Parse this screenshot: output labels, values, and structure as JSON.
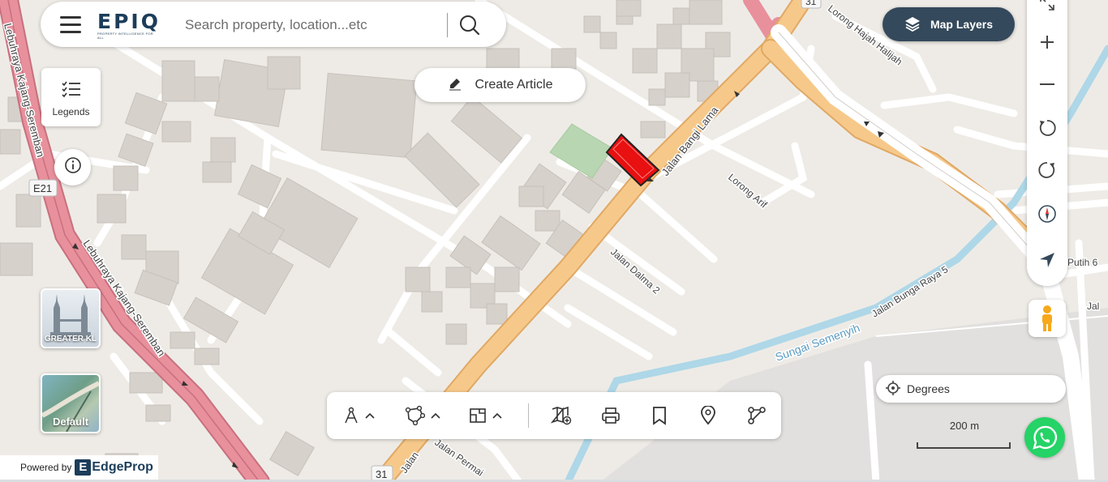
{
  "app": {
    "logo_text": "EPIQ",
    "logo_subtext": "PROPERTY INTELLIGENCE FOR ALL",
    "powered_by_label": "Powered by",
    "powered_by_brand": "EdgeProp",
    "powered_by_brand_icon": "E"
  },
  "search": {
    "placeholder": "Search property, location...etc",
    "value": ""
  },
  "buttons": {
    "create_article": "Create Article",
    "legends": "Legends",
    "map_layers": "Map Layers",
    "degrees": "Degrees"
  },
  "map_tiles": {
    "region": "GREATER KL",
    "basemap": "Default"
  },
  "scale": {
    "label": "200 m"
  },
  "map_labels": {
    "lebuhraya_upper": "Lebuhraya Kajang-Seremban",
    "lebuhraya_lower": "Lebuhraya Kajang-Seremban",
    "e21": "E21",
    "route31_top": "31",
    "route31_bottom": "31",
    "lorong_hajah": "Lorong Hajah Halijah",
    "jalan_bangi": "Jalan Bangi Lama",
    "lorong_arif": "Lorong Arif",
    "jalan_dalma": "Jalan Dalma 2",
    "jalan_bunga": "Jalan Bunga Raya 5",
    "sungai": "Sungai Semenyih",
    "jalan_permai": "Jalan Permai",
    "jalan_partial": "Jalan",
    "jalan_right": "Jal",
    "putih": "Putih 6"
  },
  "icons": {
    "menu": "hamburger-icon",
    "search": "search-icon",
    "edit": "pencil-icon",
    "legends": "list-check-icon",
    "info": "info-icon",
    "layers": "layers-icon",
    "zoom_in": "plus-icon",
    "zoom_out": "minus-icon",
    "rotate_ccw": "rotate-left-icon",
    "rotate_cw": "rotate-right-icon",
    "compass": "compass-icon",
    "locate": "navigation-arrow-icon",
    "street_view": "pegman-icon",
    "target": "crosshair-icon",
    "whatsapp": "whatsapp-icon"
  },
  "colors": {
    "highway": "#e8909c",
    "main_road": "#f6c98a",
    "river": "#aed7e8",
    "selected_lot": "#e81010",
    "park": "#b7d6b1",
    "building": "#d6d1cb",
    "map_layers_bg": "#34495b",
    "whatsapp": "#25d366"
  }
}
